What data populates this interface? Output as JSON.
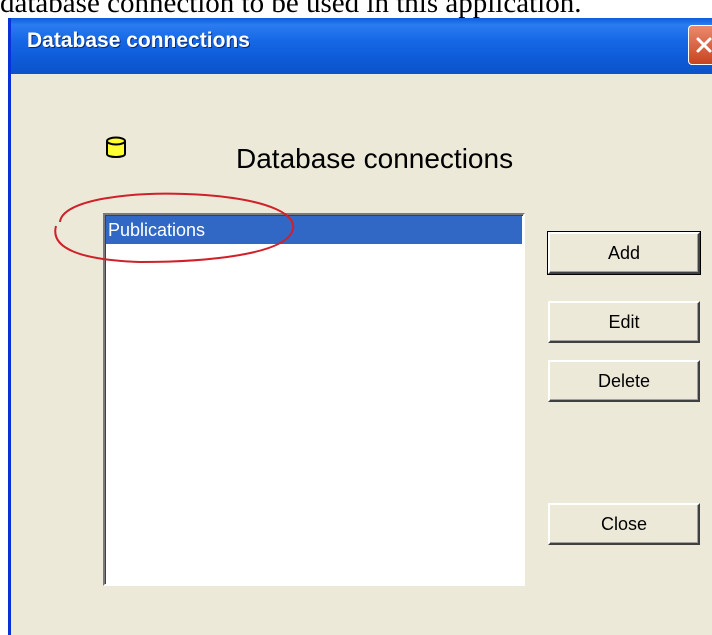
{
  "document": {
    "text": "database connection to be used in this application."
  },
  "window": {
    "title": "Database connections",
    "close_icon": "close-x-icon"
  },
  "dialog": {
    "heading": "Database connections",
    "icon": "database-cylinder-icon",
    "connections": [
      "Publications"
    ],
    "selected_connection": "Publications"
  },
  "buttons": {
    "add": "Add",
    "edit": "Edit",
    "delete": "Delete",
    "close": "Close"
  },
  "colors": {
    "titlebar": "#0f5cd9",
    "dialog_bg": "#ece9d8",
    "selection": "#3168c6",
    "annotation_circle": "#d0202a",
    "close_button": "#c94420"
  }
}
